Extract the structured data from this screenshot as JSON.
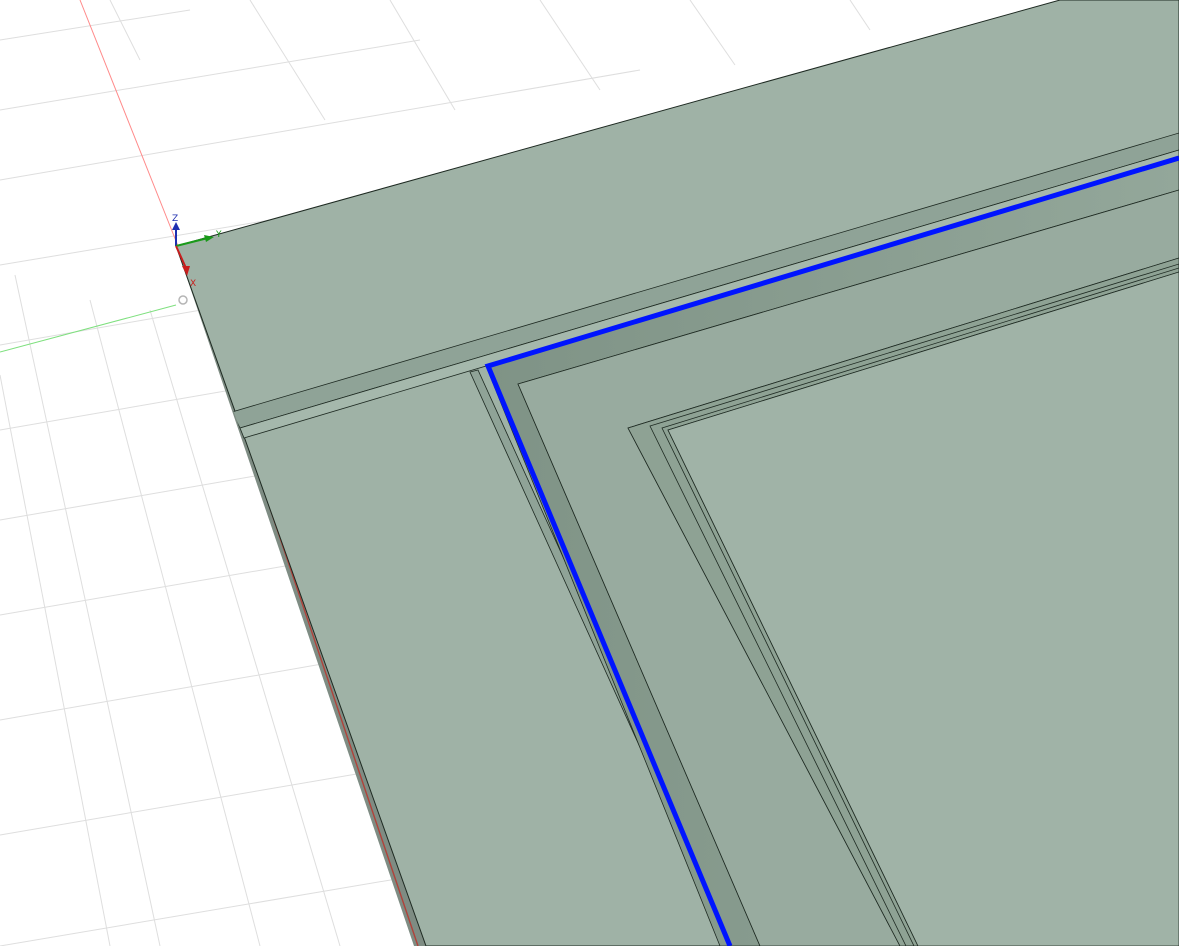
{
  "viewport": {
    "background_color": "#ffffff",
    "grid_color": "#dcdcdc",
    "model_color": "#9fb2a6",
    "selection_color": "#0014ff"
  },
  "axis_triad": {
    "z_label": "Z",
    "y_label": "Y",
    "x_label": "X",
    "z_color": "#1f2fb0",
    "y_color": "#1a9a1a",
    "x_color": "#c81e1e"
  },
  "world_axes": {
    "x_axis_color": "#ff6b6b",
    "y_axis_color": "#6fdc6f"
  },
  "selection": {
    "type": "edge-loop",
    "highlighted": true
  }
}
